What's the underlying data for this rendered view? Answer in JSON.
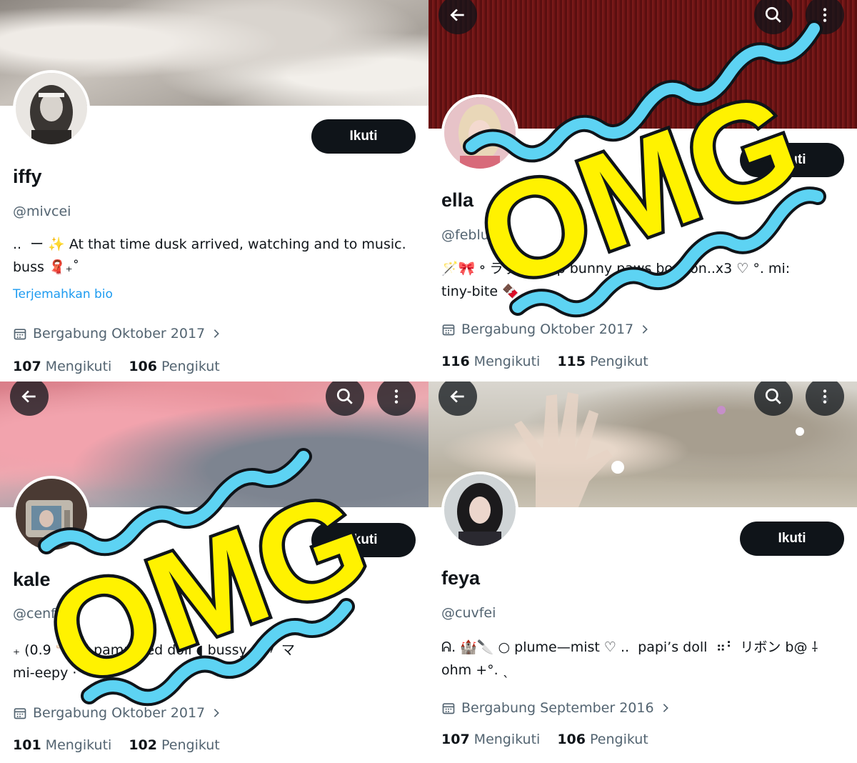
{
  "profiles": [
    {
      "name": "iffy",
      "handle": "@mivcei",
      "bio_line1": "..  ー ✨ At that time dusk arrived, watching and to music.",
      "bio_line2": "buss 🧣₊˚",
      "translate": "Terjemahkan bio",
      "joined": "Bergabung Oktober 2017",
      "following_count": "107",
      "following_label": "Mengikuti",
      "followers_count": "106",
      "followers_label": "Pengikut",
      "follow_label": "Ikuti"
    },
    {
      "name": "ella",
      "handle": "@febluz",
      "bio_line1": "🪄🎀 ॰ ラッキ (nap bunny paws bonbon..x3 ♡ °. mi:",
      "bio_line2": "tiny-bite 🍫",
      "joined": "Bergabung Oktober 2017",
      "following_count": "116",
      "following_label": "Mengikuti",
      "followers_count": "115",
      "followers_label": "Pengikut",
      "follow_label": "Ikuti",
      "omg": "OMG"
    },
    {
      "name": "kale",
      "handle": "@cenfu",
      "bio_line1": "₊ (0.9 🦴🎀 pampered doll ◖ bussy ♡〃 マ",
      "bio_line2": "mi-eepy ⋅˚",
      "joined": "Bergabung Oktober 2017",
      "following_count": "101",
      "following_label": "Mengikuti",
      "followers_count": "102",
      "followers_label": "Pengikut",
      "follow_label": "Ikuti",
      "omg": "OMG"
    },
    {
      "name": "feya",
      "handle": "@cuvfei",
      "bio_line1": "ᕱ. 🏰🔪 ○ plume—mist ♡ ..  papi’s doll  ⠶⠃ リボン b@ ⸸",
      "bio_line2": "ohm +°. ˎ",
      "joined": "Bergabung September 2016",
      "following_count": "107",
      "following_label": "Mengikuti",
      "followers_count": "106",
      "followers_label": "Pengikut",
      "follow_label": "Ikuti"
    }
  ],
  "icons": {
    "back": "back-arrow-icon",
    "search": "search-icon",
    "more": "more-vertical-icon",
    "calendar": "calendar-icon",
    "chevron": "chevron-right-icon"
  },
  "colors": {
    "follow_button": "#0f1419",
    "link": "#1d9bf0",
    "muted_text": "#536471",
    "omg_fill": "#fff200",
    "squiggle": "#5dd3f3"
  }
}
